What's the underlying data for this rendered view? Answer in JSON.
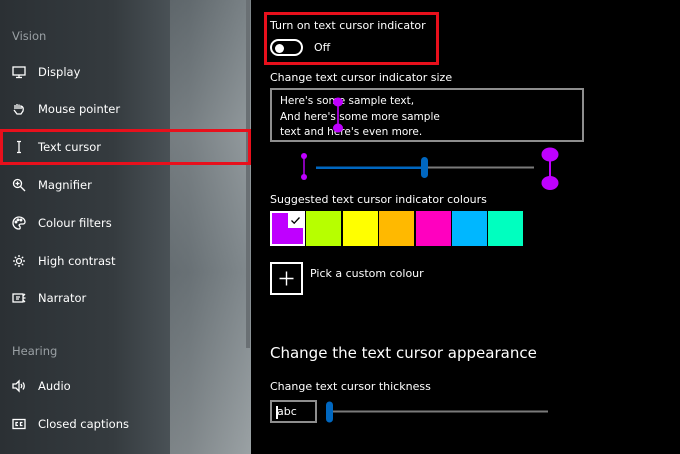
{
  "sidebar": {
    "sections": [
      {
        "heading": "Vision"
      },
      {
        "heading": "Hearing"
      }
    ],
    "items": [
      {
        "label": "Display",
        "icon": "display-icon"
      },
      {
        "label": "Mouse pointer",
        "icon": "mouse-pointer-icon"
      },
      {
        "label": "Text cursor",
        "icon": "text-cursor-icon",
        "selected": true
      },
      {
        "label": "Magnifier",
        "icon": "magnifier-icon"
      },
      {
        "label": "Colour filters",
        "icon": "colour-filters-icon"
      },
      {
        "label": "High contrast",
        "icon": "high-contrast-icon"
      },
      {
        "label": "Narrator",
        "icon": "narrator-icon"
      },
      {
        "label": "Audio",
        "icon": "audio-icon"
      },
      {
        "label": "Closed captions",
        "icon": "closed-captions-icon"
      }
    ]
  },
  "indicator": {
    "title": "Turn on text cursor indicator",
    "toggle_state": "Off"
  },
  "size": {
    "title": "Change text cursor indicator size",
    "sample_lines": [
      "Here's some sample text,",
      "And here's some more sample",
      "text and here's even more."
    ],
    "slider_level": 0.4
  },
  "colours": {
    "title": "Suggested text cursor indicator colours",
    "swatches": [
      "#bf00ff",
      "#b7ff00",
      "#ffff00",
      "#ffb900",
      "#ff00bf",
      "#00b7ff",
      "#00ffbf"
    ],
    "selected_index": 0,
    "custom_label": "Pick a custom colour"
  },
  "appearance": {
    "heading": "Change the text cursor appearance",
    "thickness_title": "Change text cursor thickness",
    "preview_text": "abc",
    "slider_level": 0.0
  },
  "accent": "#0067c0",
  "highlight_color": "#e8101c",
  "indicator_color": "#bf00ff"
}
